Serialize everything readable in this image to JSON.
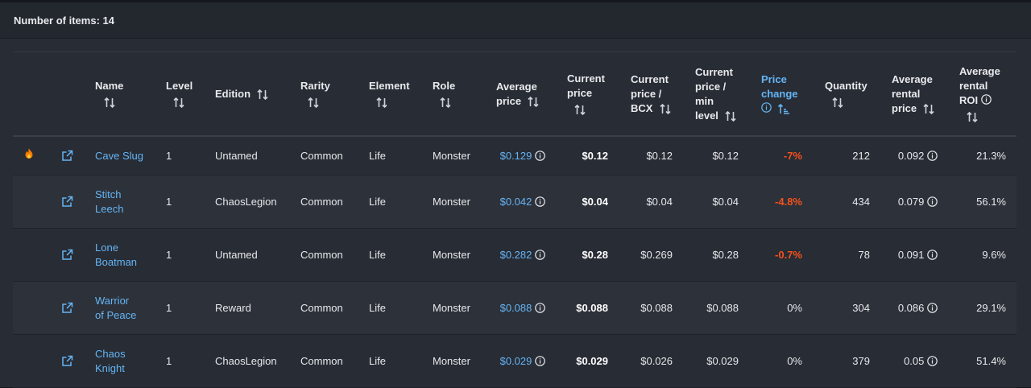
{
  "header": {
    "count_label": "Number of items: 14"
  },
  "columns": {
    "name": "Name",
    "level": "Level",
    "edition": "Edition",
    "rarity": "Rarity",
    "element": "Element",
    "role": "Role",
    "avg_price_1": "Average",
    "avg_price_2": "price",
    "cur_price_1": "Current",
    "cur_price_2": "price",
    "bcx_1": "Current",
    "bcx_2": "price /",
    "bcx_3": "BCX",
    "minlvl_1": "Current",
    "minlvl_2": "price /",
    "minlvl_3": "min",
    "minlvl_4": "level",
    "pc_1": "Price",
    "pc_2": "change",
    "quantity": "Quantity",
    "rent_1": "Average",
    "rent_2": "rental",
    "rent_3": "price",
    "roi_1": "Average",
    "roi_2": "rental",
    "roi_3": "ROI"
  },
  "rows": [
    {
      "fire": true,
      "name1": "Cave Slug",
      "name2": "",
      "level": "1",
      "edition": "Untamed",
      "rarity": "Common",
      "element": "Life",
      "role": "Monster",
      "avg_price": "$0.129",
      "cur_price": "$0.12",
      "bcx_price": "$0.12",
      "min_level_price": "$0.12",
      "price_change": "-7%",
      "quantity": "212",
      "rental_price": "0.092",
      "roi": "21.3%"
    },
    {
      "fire": false,
      "name1": "Stitch",
      "name2": "Leech",
      "level": "1",
      "edition": "ChaosLegion",
      "rarity": "Common",
      "element": "Life",
      "role": "Monster",
      "avg_price": "$0.042",
      "cur_price": "$0.04",
      "bcx_price": "$0.04",
      "min_level_price": "$0.04",
      "price_change": "-4.8%",
      "quantity": "434",
      "rental_price": "0.079",
      "roi": "56.1%"
    },
    {
      "fire": false,
      "name1": "Lone",
      "name2": "Boatman",
      "level": "1",
      "edition": "Untamed",
      "rarity": "Common",
      "element": "Life",
      "role": "Monster",
      "avg_price": "$0.282",
      "cur_price": "$0.28",
      "bcx_price": "$0.269",
      "min_level_price": "$0.28",
      "price_change": "-0.7%",
      "quantity": "78",
      "rental_price": "0.091",
      "roi": "9.6%"
    },
    {
      "fire": false,
      "name1": "Warrior",
      "name2": "of Peace",
      "level": "1",
      "edition": "Reward",
      "rarity": "Common",
      "element": "Life",
      "role": "Monster",
      "avg_price": "$0.088",
      "cur_price": "$0.088",
      "bcx_price": "$0.088",
      "min_level_price": "$0.088",
      "price_change": "0%",
      "quantity": "304",
      "rental_price": "0.086",
      "roi": "29.1%"
    },
    {
      "fire": false,
      "name1": "Chaos",
      "name2": "Knight",
      "level": "1",
      "edition": "ChaosLegion",
      "rarity": "Common",
      "element": "Life",
      "role": "Monster",
      "avg_price": "$0.029",
      "cur_price": "$0.029",
      "bcx_price": "$0.026",
      "min_level_price": "$0.029",
      "price_change": "0%",
      "quantity": "379",
      "rental_price": "0.05",
      "roi": "51.4%"
    }
  ],
  "colors": {
    "link": "#64b5f6",
    "negative": "#f4511e",
    "background": "#282c34"
  },
  "icons": {
    "sort": "sort-arrows-icon",
    "info": "info-circle-icon",
    "external": "external-link-icon",
    "fire": "fire-icon"
  }
}
